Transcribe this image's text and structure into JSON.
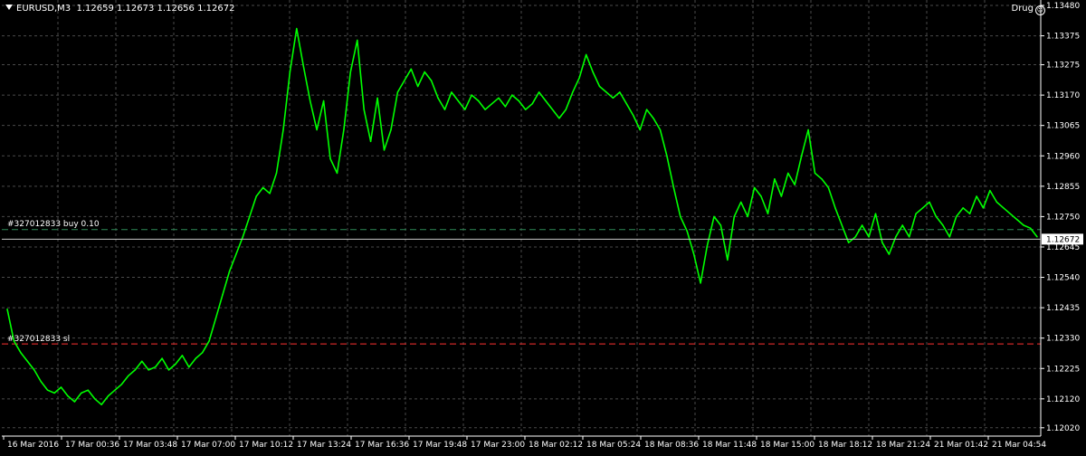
{
  "header": {
    "symbol": "EURUSD,M3",
    "ohlc": "1.12659 1.12673 1.12656 1.12672",
    "ea_name": "Drug"
  },
  "colors": {
    "background": "#000000",
    "grid": "#4a4a4a",
    "price_line": "#00ff00",
    "order_line": "#2e8b57",
    "sl_line": "#ff3030",
    "axis_text": "#ffffff",
    "current_price_box": "#ffffff"
  },
  "orders": {
    "buy_label": "#327012833 buy 0.10",
    "buy_price": 1.12705,
    "sl_label": "#327012833 sl",
    "sl_price": 1.1231
  },
  "current_price": {
    "label": "1.12672",
    "value": 1.12672
  },
  "chart_data": {
    "type": "line",
    "ylim": [
      1.1201,
      1.1348
    ],
    "y_ticks": [
      "1.13480",
      "1.13375",
      "1.13275",
      "1.13170",
      "1.13065",
      "1.12960",
      "1.12855",
      "1.12750",
      "1.12645",
      "1.12540",
      "1.12435",
      "1.12330",
      "1.12225",
      "1.12120",
      "1.12020"
    ],
    "x_ticks": [
      "16 Mar 2016",
      "17 Mar 00:36",
      "17 Mar 03:48",
      "17 Mar 07:00",
      "17 Mar 10:12",
      "17 Mar 13:24",
      "17 Mar 16:36",
      "17 Mar 19:48",
      "17 Mar 23:00",
      "18 Mar 02:12",
      "18 Mar 05:24",
      "18 Mar 08:36",
      "18 Mar 11:48",
      "18 Mar 15:00",
      "18 Mar 18:12",
      "18 Mar 21:24",
      "21 Mar 01:42",
      "21 Mar 04:54"
    ],
    "x_tick_labels_index": [
      0,
      64,
      128,
      192,
      256,
      320,
      384,
      448,
      512,
      576,
      640,
      704,
      768,
      832,
      896,
      960,
      1024,
      1088
    ],
    "grid": true,
    "series": [
      {
        "values": [
          1.1243,
          1.1232,
          1.1228,
          1.1225,
          1.1222,
          1.1218,
          1.1215,
          1.1214,
          1.1216,
          1.1213,
          1.1211,
          1.1214,
          1.1215,
          1.1212,
          1.121,
          1.1213,
          1.1215,
          1.1217,
          1.122,
          1.1222,
          1.1225,
          1.1222,
          1.1223,
          1.1226,
          1.1222,
          1.1224,
          1.1227,
          1.1223,
          1.1226,
          1.1228,
          1.1232,
          1.124,
          1.1248,
          1.1256,
          1.1262,
          1.1268,
          1.1275,
          1.1282,
          1.1285,
          1.1283,
          1.129,
          1.1305,
          1.1325,
          1.134,
          1.1327,
          1.1315,
          1.1305,
          1.1315,
          1.1295,
          1.129,
          1.1305,
          1.1325,
          1.1336,
          1.1312,
          1.1301,
          1.1316,
          1.1298,
          1.1305,
          1.1318,
          1.1322,
          1.1326,
          1.132,
          1.1325,
          1.1322,
          1.1316,
          1.1312,
          1.1318,
          1.1315,
          1.1312,
          1.1317,
          1.1315,
          1.1312,
          1.1314,
          1.1316,
          1.1313,
          1.1317,
          1.1315,
          1.1312,
          1.1314,
          1.1318,
          1.1315,
          1.1312,
          1.1309,
          1.1312,
          1.1318,
          1.1323,
          1.1331,
          1.1325,
          1.132,
          1.1318,
          1.1316,
          1.1318,
          1.1314,
          1.131,
          1.1305,
          1.1312,
          1.1309,
          1.1305,
          1.1296,
          1.1285,
          1.1275,
          1.127,
          1.1262,
          1.1252,
          1.1265,
          1.1275,
          1.1272,
          1.126,
          1.1275,
          1.128,
          1.1275,
          1.1285,
          1.1282,
          1.1276,
          1.1288,
          1.1282,
          1.129,
          1.1286,
          1.1296,
          1.1305,
          1.129,
          1.1288,
          1.1285,
          1.1278,
          1.1272,
          1.1266,
          1.1268,
          1.1272,
          1.1268,
          1.1276,
          1.1266,
          1.1262,
          1.1268,
          1.1272,
          1.1268,
          1.1276,
          1.1278,
          1.128,
          1.1275,
          1.1272,
          1.1268,
          1.1275,
          1.1278,
          1.1276,
          1.1282,
          1.1278,
          1.1284,
          1.128,
          1.1278,
          1.1276,
          1.1274,
          1.1272,
          1.1271,
          1.1268
        ]
      }
    ]
  }
}
